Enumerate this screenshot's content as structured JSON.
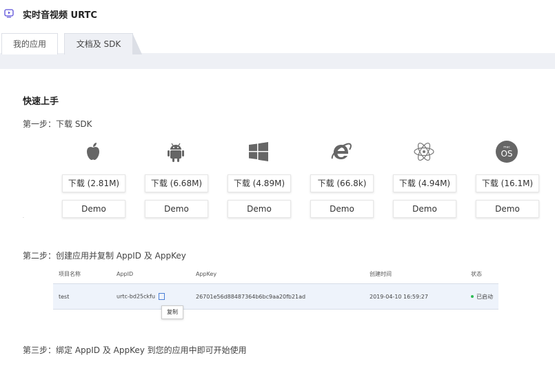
{
  "app": {
    "title": "实时音视频 URTC"
  },
  "tabs": [
    {
      "label": "我的应用",
      "active": false
    },
    {
      "label": "文档及 SDK",
      "active": true
    }
  ],
  "main": {
    "heading": "快速上手",
    "step1": "第一步：下载 SDK",
    "step2": "第二步：创建应用并复制 AppID 及 AppKey",
    "step3": "第三步：绑定 AppID 及 AppKey 到您的应用中即可开始使用",
    "stray_mark": "."
  },
  "platforms": [
    {
      "icon": "apple-icon",
      "download": "下载 (2.81M)",
      "demo": "Demo"
    },
    {
      "icon": "android-icon",
      "download": "下载 (6.68M)",
      "demo": "Demo"
    },
    {
      "icon": "windows-icon",
      "download": "下载 (4.89M)",
      "demo": "Demo"
    },
    {
      "icon": "internet-explorer-icon",
      "download": "下载 (66.8k)",
      "demo": "Demo"
    },
    {
      "icon": "electron-icon",
      "download": "下载 (4.94M)",
      "demo": "Demo"
    },
    {
      "icon": "macos-icon",
      "icon_text": "OS",
      "icon_subtext": "mac",
      "download": "下载 (16.1M)",
      "demo": "Demo"
    }
  ],
  "table": {
    "columns": [
      "项目名称",
      "AppID",
      "AppKey",
      "创建时间",
      "状态"
    ],
    "rows": [
      {
        "name": "test",
        "appid": "urtc-bd25ckfu",
        "appkey": "26701e56d88487364b6bc9aa20fb21ad",
        "created": "2019-04-10 16:59:27",
        "status": "已启动"
      }
    ]
  },
  "tooltip": {
    "label": "复制"
  },
  "colors": {
    "accent": "#4a7fd6",
    "status_green": "#2dbb55",
    "band": "#eef0f5"
  }
}
